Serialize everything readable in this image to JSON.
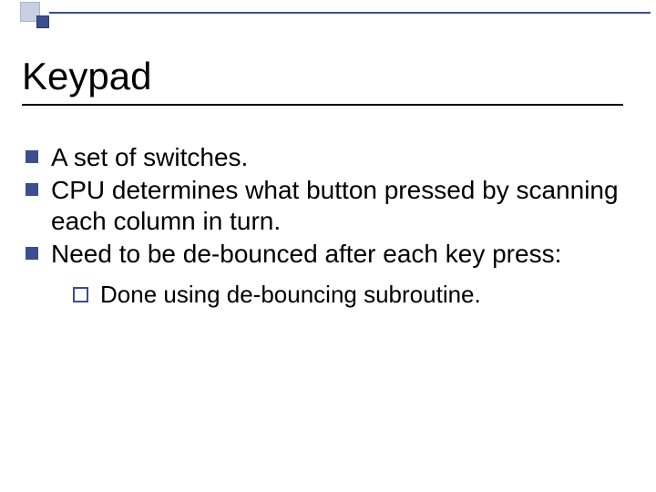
{
  "title": "Keypad",
  "bullets": [
    {
      "text": "A set of switches."
    },
    {
      "text": "CPU determines what button pressed by scanning each column in turn."
    },
    {
      "text": "Need to be de-bounced after each key press:"
    }
  ],
  "sub": [
    {
      "text": "Done using de-bouncing subroutine."
    }
  ]
}
